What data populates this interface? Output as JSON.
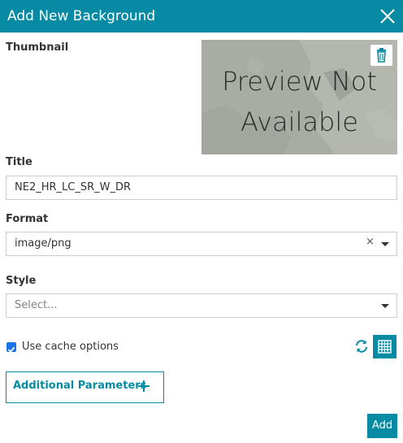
{
  "header": {
    "title": "Add New Background",
    "close_icon": "close-icon"
  },
  "thumbnail": {
    "label": "Thumbnail",
    "preview_line1": "Preview Not",
    "preview_line2": "Available",
    "delete_icon": "trash-icon"
  },
  "title_field": {
    "label": "Title",
    "value": "NE2_HR_LC_SR_W_DR"
  },
  "format_field": {
    "label": "Format",
    "value": "image/png",
    "clear_symbol": "×"
  },
  "style_field": {
    "label": "Style",
    "placeholder": "Select..."
  },
  "cache": {
    "label": "Use cache options",
    "checked": true
  },
  "actions": {
    "refresh_icon": "refresh-icon",
    "grid_icon": "grid-icon",
    "additional_parameters_label": "Additional Parameters",
    "add_label": "Add"
  },
  "colors": {
    "accent": "#078aa3",
    "checkbox": "#1a73e8"
  }
}
